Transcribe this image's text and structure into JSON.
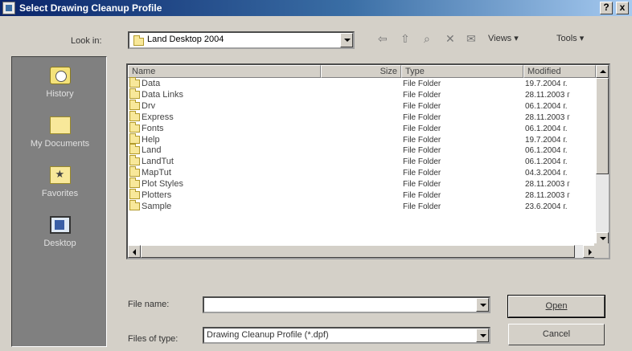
{
  "window": {
    "title": "Select Drawing Cleanup Profile",
    "help_label": "?",
    "close_label": "x"
  },
  "lookin": {
    "label": "Look in:",
    "value": "Land Desktop 2004"
  },
  "toolbar": {
    "views_label": "Views",
    "tools_label": "Tools",
    "arrow": "▾"
  },
  "places": [
    {
      "label": "History",
      "icon": "history-icon"
    },
    {
      "label": "My Documents",
      "icon": "my-documents-icon"
    },
    {
      "label": "Favorites",
      "icon": "favorites-icon"
    },
    {
      "label": "Desktop",
      "icon": "desktop-icon"
    }
  ],
  "columns": {
    "name": "Name",
    "size": "Size",
    "type": "Type",
    "modified": "Modified"
  },
  "files": [
    {
      "name": "Data",
      "type": "File Folder",
      "modified": "19.7.2004 г."
    },
    {
      "name": "Data Links",
      "type": "File Folder",
      "modified": "28.11.2003 г"
    },
    {
      "name": "Drv",
      "type": "File Folder",
      "modified": "06.1.2004 г."
    },
    {
      "name": "Express",
      "type": "File Folder",
      "modified": "28.11.2003 г"
    },
    {
      "name": "Fonts",
      "type": "File Folder",
      "modified": "06.1.2004 г."
    },
    {
      "name": "Help",
      "type": "File Folder",
      "modified": "19.7.2004 г."
    },
    {
      "name": "Land",
      "type": "File Folder",
      "modified": "06.1.2004 г."
    },
    {
      "name": "LandTut",
      "type": "File Folder",
      "modified": "06.1.2004 г."
    },
    {
      "name": "MapTut",
      "type": "File Folder",
      "modified": "04.3.2004 г."
    },
    {
      "name": "Plot Styles",
      "type": "File Folder",
      "modified": "28.11.2003 г"
    },
    {
      "name": "Plotters",
      "type": "File Folder",
      "modified": "28.11.2003 г"
    },
    {
      "name": "Sample",
      "type": "File Folder",
      "modified": "23.6.2004 г."
    }
  ],
  "filename": {
    "label": "File name:",
    "value": ""
  },
  "filetype": {
    "label": "Files of type:",
    "value": "Drawing Cleanup Profile (*.dpf)"
  },
  "buttons": {
    "open": "Open",
    "cancel": "Cancel"
  }
}
